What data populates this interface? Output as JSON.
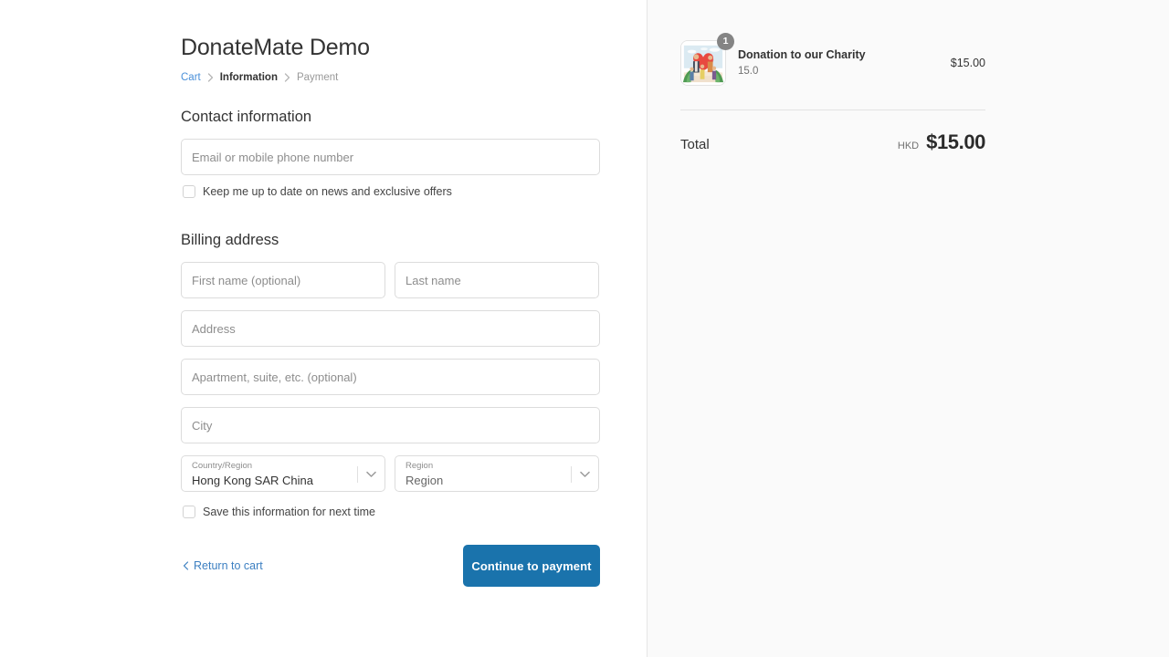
{
  "brand": {
    "title": "DonateMate Demo"
  },
  "breadcrumb": {
    "cart": "Cart",
    "information": "Information",
    "payment": "Payment"
  },
  "contact": {
    "heading": "Contact information",
    "email_placeholder": "Email or mobile phone number",
    "email_value": "",
    "newsletter_label": "Keep me up to date on news and exclusive offers"
  },
  "billing": {
    "heading": "Billing address",
    "first_name_placeholder": "First name (optional)",
    "first_name_value": "",
    "last_name_placeholder": "Last name",
    "last_name_value": "",
    "address_placeholder": "Address",
    "address_value": "",
    "apartment_placeholder": "Apartment, suite, etc. (optional)",
    "apartment_value": "",
    "city_placeholder": "City",
    "city_value": "",
    "country_label": "Country/Region",
    "country_value": "Hong Kong SAR China",
    "region_label": "Region",
    "region_value": "Region",
    "save_label": "Save this information for next time"
  },
  "actions": {
    "return_label": "Return to cart",
    "continue_label": "Continue to payment",
    "continue_color": "#1a73ac"
  },
  "summary": {
    "item": {
      "name": "Donation to our Charity",
      "variant": "15.0",
      "price": "$15.00",
      "quantity": "1",
      "image_alt": "charity-heart-illustration"
    },
    "total_label": "Total",
    "total_currency": "HKD",
    "total_amount": "$15.00"
  }
}
